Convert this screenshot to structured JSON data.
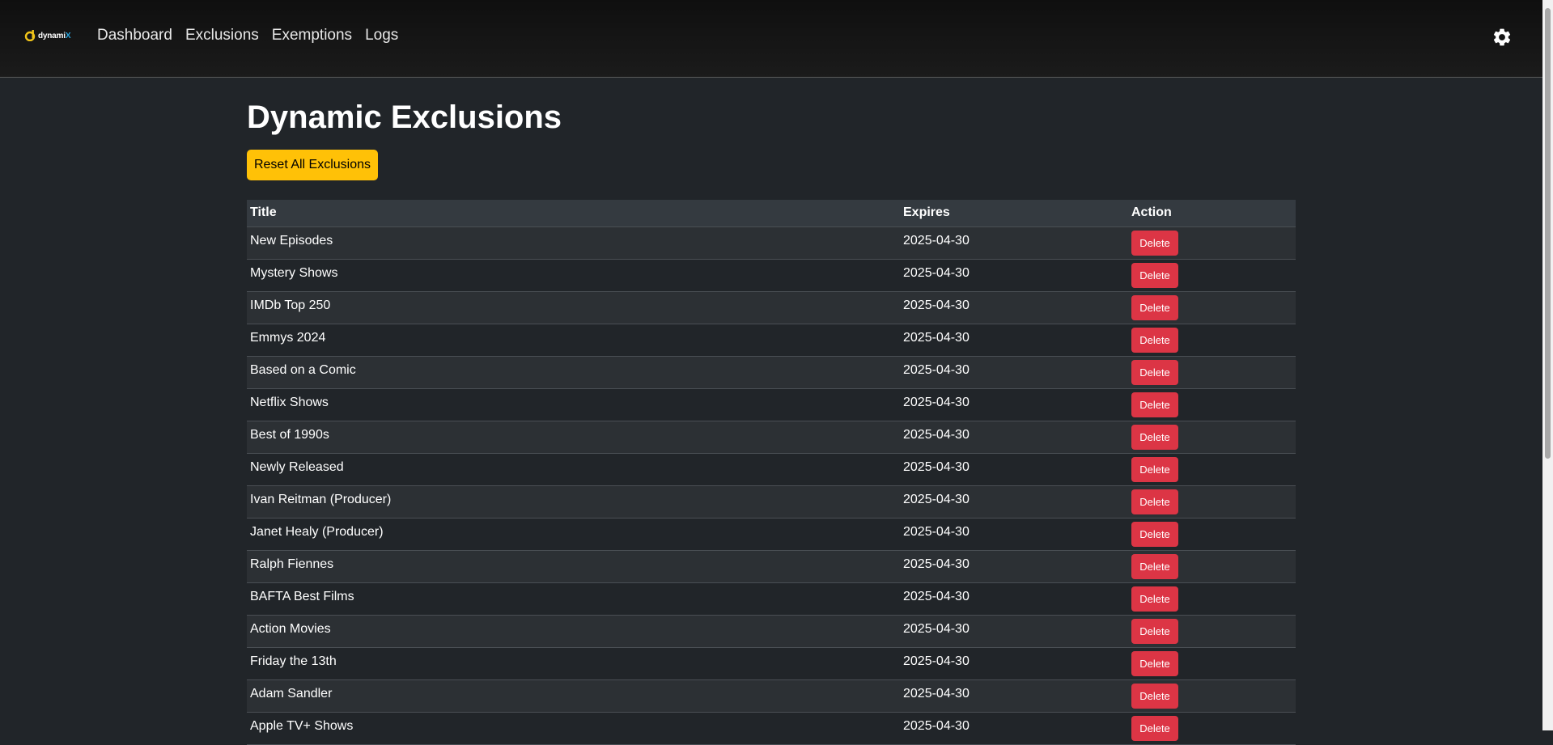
{
  "nav": {
    "logo": {
      "text_main": "dynami",
      "text_accent": "X",
      "accent_color": "#2aa7e0",
      "mark_color": "#f0c419"
    },
    "links": [
      "Dashboard",
      "Exclusions",
      "Exemptions",
      "Logs"
    ],
    "settings_icon": "gear-icon"
  },
  "page": {
    "title": "Dynamic Exclusions",
    "reset_button": "Reset All Exclusions"
  },
  "table": {
    "headers": {
      "title": "Title",
      "expires": "Expires",
      "action": "Action"
    },
    "delete_label": "Delete",
    "rows": [
      {
        "title": "New Episodes",
        "expires": "2025-04-30"
      },
      {
        "title": "Mystery Shows",
        "expires": "2025-04-30"
      },
      {
        "title": "IMDb Top 250",
        "expires": "2025-04-30"
      },
      {
        "title": "Emmys 2024",
        "expires": "2025-04-30"
      },
      {
        "title": "Based on a Comic",
        "expires": "2025-04-30"
      },
      {
        "title": "Netflix Shows",
        "expires": "2025-04-30"
      },
      {
        "title": "Best of 1990s",
        "expires": "2025-04-30"
      },
      {
        "title": "Newly Released",
        "expires": "2025-04-30"
      },
      {
        "title": "Ivan Reitman (Producer)",
        "expires": "2025-04-30"
      },
      {
        "title": "Janet Healy (Producer)",
        "expires": "2025-04-30"
      },
      {
        "title": "Ralph Fiennes",
        "expires": "2025-04-30"
      },
      {
        "title": "BAFTA Best Films",
        "expires": "2025-04-30"
      },
      {
        "title": "Action Movies",
        "expires": "2025-04-30"
      },
      {
        "title": "Friday the 13th",
        "expires": "2025-04-30"
      },
      {
        "title": "Adam Sandler",
        "expires": "2025-04-30"
      },
      {
        "title": "Apple TV+ Shows",
        "expires": "2025-04-30"
      }
    ]
  },
  "colors": {
    "background": "#212529",
    "warning": "#ffc107",
    "danger": "#dc3545",
    "header_row": "#343a40"
  }
}
